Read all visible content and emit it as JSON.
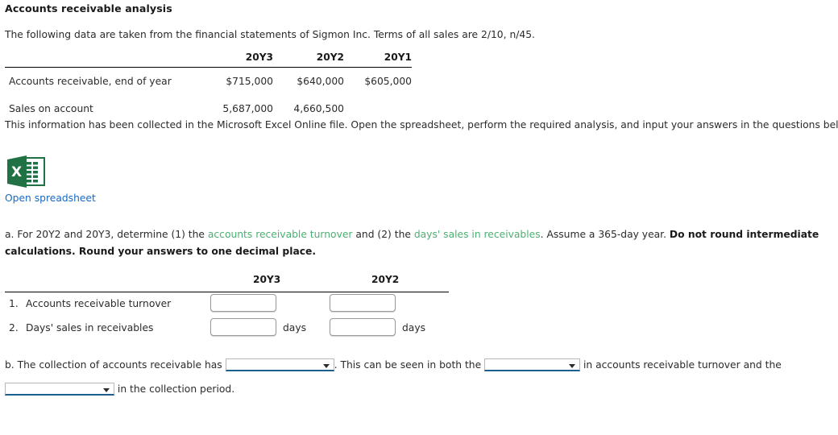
{
  "page": {
    "title": "Accounts receivable analysis",
    "intro": "The following data are taken from the financial statements of Sigmon Inc. Terms of all sales are 2/10, n/45.",
    "collected_note": "This information has been collected in the Microsoft Excel Online file. Open the spreadsheet, perform the required analysis, and input your answers in the questions below."
  },
  "data_table": {
    "columns": [
      "",
      "20Y3",
      "20Y2",
      "20Y1"
    ],
    "rows": [
      {
        "label": "Accounts receivable, end of year",
        "y3": "$715,000",
        "y2": "$640,000",
        "y1": "$605,000"
      },
      {
        "label": "Sales on account",
        "y3": "5,687,000",
        "y2": "4,660,500",
        "y1": ""
      }
    ]
  },
  "spreadsheet": {
    "icon": "excel-file-icon",
    "link_label": "Open spreadsheet"
  },
  "question_a": {
    "part1": "a. For 20Y2 and 20Y3, determine (1) the ",
    "link1": "accounts receivable turnover",
    "part2": " and (2) the ",
    "link2": "days' sales in receivables",
    "part3": ". Assume a 365-day year. ",
    "bold": "Do not round intermediate calculations. Round your answers to one decimal place."
  },
  "answer_table": {
    "columns": [
      "20Y3",
      "20Y2"
    ],
    "rows": [
      {
        "number": "1.",
        "label": "Accounts receivable turnover",
        "y3_value": "",
        "y2_value": "",
        "y3_unit": "",
        "y2_unit": ""
      },
      {
        "number": "2.",
        "label": "Days' sales in receivables",
        "y3_value": "",
        "y2_value": "",
        "y3_unit": "days",
        "y2_unit": "days"
      }
    ]
  },
  "question_b": {
    "part1": "b. The collection of accounts receivable has ",
    "dropdown1_value": "",
    "part2": ". This can be seen in both the ",
    "dropdown2_value": "",
    "part3": " in accounts receivable turnover and the ",
    "dropdown3_value": "",
    "part4": " in the collection period."
  },
  "colors": {
    "link_blue": "#1569c7",
    "term_green": "#4caf72",
    "dropdown_underline": "#1c5e8e",
    "excel_green": "#207245"
  }
}
